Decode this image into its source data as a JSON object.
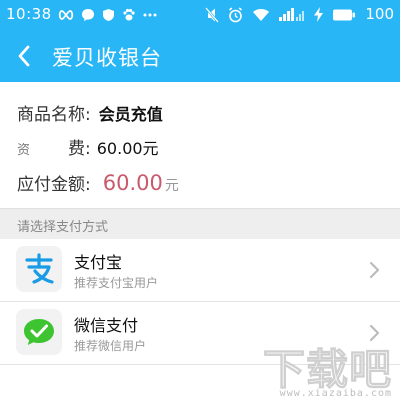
{
  "status_bar": {
    "time": "10:38",
    "battery": "100",
    "left_icons": [
      "infinity-icon",
      "chat-bubble-icon",
      "shield-icon",
      "paw-icon",
      "more-dots-icon"
    ],
    "right_icons": [
      "mute-icon",
      "alarm-icon",
      "wifi-icon",
      "signal-icon",
      "charging-icon",
      "battery-icon"
    ]
  },
  "nav": {
    "title": "爱贝收银台"
  },
  "order": {
    "product_label": "商品名称:",
    "product_value": "会员充值",
    "fee_label_a": "资",
    "fee_label_b": "费:",
    "fee_value": "60.00元",
    "due_label": "应付金额:",
    "due_amount": "60.00",
    "due_unit": "元"
  },
  "payment": {
    "section_title": "请选择支付方式",
    "options": [
      {
        "name": "支付宝",
        "desc": "推荐支付宝用户",
        "icon": "alipay-icon"
      },
      {
        "name": "微信支付",
        "desc": "推荐微信用户",
        "icon": "wechat-pay-icon"
      }
    ]
  },
  "watermark": {
    "mark": "下载吧",
    "url": "www.xiazaiba.com"
  },
  "colors": {
    "primary": "#29b6f6",
    "amount": "#c85a6c",
    "alipay": "#1a9be6",
    "wechat": "#3ec431"
  }
}
